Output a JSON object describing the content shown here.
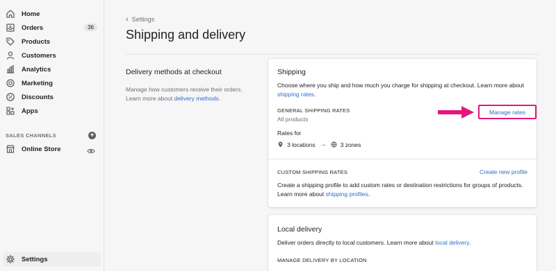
{
  "sidebar": {
    "items": [
      {
        "label": "Home",
        "icon": "home-icon"
      },
      {
        "label": "Orders",
        "icon": "orders-icon",
        "badge": "36"
      },
      {
        "label": "Products",
        "icon": "tag-icon"
      },
      {
        "label": "Customers",
        "icon": "person-icon"
      },
      {
        "label": "Analytics",
        "icon": "bar-chart-icon"
      },
      {
        "label": "Marketing",
        "icon": "target-icon"
      },
      {
        "label": "Discounts",
        "icon": "discount-icon"
      },
      {
        "label": "Apps",
        "icon": "apps-icon"
      }
    ],
    "sales_channels_heading": "SALES CHANNELS",
    "online_store_label": "Online Store",
    "settings_label": "Settings"
  },
  "breadcrumb": {
    "label": "Settings"
  },
  "page": {
    "title": "Shipping and delivery"
  },
  "section": {
    "title": "Delivery methods at checkout",
    "text": "Manage how customers receive their orders. Learn more about ",
    "link": "delivery methods",
    "text_end": "."
  },
  "shipping_card": {
    "title": "Shipping",
    "text": "Choose where you ship and how much you charge for shipping at checkout. Learn more about ",
    "link": "shipping rates",
    "text_end": ".",
    "general_heading": "GENERAL SHIPPING RATES",
    "all_products": "All products",
    "manage_rates": "Manage rates",
    "rates_for": "Rates for",
    "locations": "3 locations",
    "zones": "3 zones",
    "custom_heading": "CUSTOM SHIPPING RATES",
    "create_profile": "Create new profile",
    "custom_text": "Create a shipping profile to add custom rates or destination restrictions for groups of products. Learn more about ",
    "custom_link": "shipping profiles",
    "custom_end": "."
  },
  "local_card": {
    "title": "Local delivery",
    "text": "Deliver orders directly to local customers. Learn more about ",
    "link": "local delivery",
    "text_end": ".",
    "manage_heading": "MANAGE DELIVERY BY LOCATION"
  },
  "colors": {
    "link": "#2c6ecb",
    "highlight": "#e6157e"
  }
}
